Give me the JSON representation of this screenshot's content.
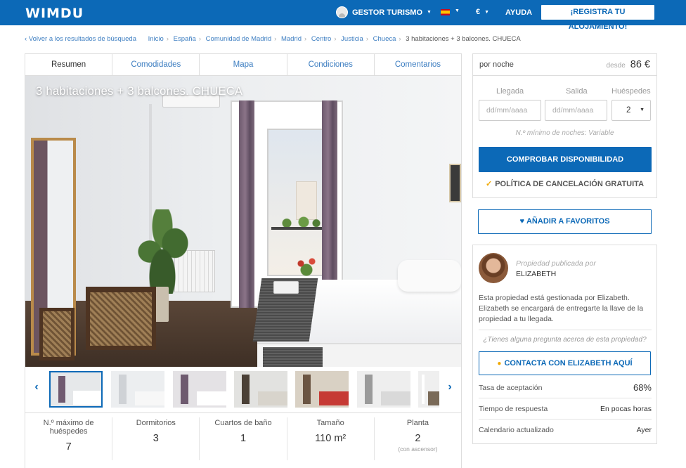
{
  "header": {
    "logo": "WIMDU",
    "user_menu": "GESTOR TURISMO",
    "currency": "€",
    "help": "AYUDA",
    "register": "¡REGISTRA TU ALOJAMIENTO!",
    "brand_color": "#0c69b7"
  },
  "breadcrumb": {
    "back": "Volver a los resultados de búsqueda",
    "items": [
      "Inicio",
      "España",
      "Comunidad de Madrid",
      "Madrid",
      "Centro",
      "Justicia",
      "Chueca"
    ],
    "current": "3 habitaciones + 3 balcones. CHUECA"
  },
  "tabs": [
    "Resumen",
    "Comodidades",
    "Mapa",
    "Condiciones",
    "Comentarios"
  ],
  "listing": {
    "title": "3 habitaciones + 3 balcones. CHUECA"
  },
  "gallery": {
    "prev_icon": "chevron-left-icon",
    "next_icon": "chevron-right-icon",
    "thumbnails": [
      {
        "bg": "#e6e8ea",
        "a": "#705a70",
        "b": "#ffffff"
      },
      {
        "bg": "#eceef0",
        "a": "#cfd2d6",
        "b": "#f7f7f7"
      },
      {
        "bg": "#e4e2e5",
        "a": "#6e5a6f",
        "b": "#ffffff"
      },
      {
        "bg": "#e2e2e0",
        "a": "#4a4036",
        "b": "#d8d4cc"
      },
      {
        "bg": "#d9d1c4",
        "a": "#6b5543",
        "b": "#c63a34"
      },
      {
        "bg": "#eeeeee",
        "a": "#9a9a9a",
        "b": "#d9d9d9"
      },
      {
        "bg": "#efefef",
        "a": "#ffffff",
        "b": "#7a6a58"
      }
    ]
  },
  "facts": [
    {
      "label": "N.º máximo de huéspedes",
      "value": "7",
      "sub": ""
    },
    {
      "label": "Dormitorios",
      "value": "3",
      "sub": ""
    },
    {
      "label": "Cuartos de baño",
      "value": "1",
      "sub": ""
    },
    {
      "label": "Tamaño",
      "value": "110 m²",
      "sub": ""
    },
    {
      "label": "Planta",
      "value": "2",
      "sub": "(con ascensor)"
    }
  ],
  "booking": {
    "per_night": "por noche",
    "from": "desde",
    "price": "86 €",
    "checkin_label": "Llegada",
    "checkout_label": "Salida",
    "guests_label": "Huéspedes",
    "checkin_placeholder": "dd/mm/aaaa",
    "checkout_placeholder": "dd/mm/aaaa",
    "guests_value": "2",
    "min_nights": "N.º mínimo de noches: Variable",
    "check_button": "COMPROBAR DISPONIBILIDAD",
    "cancellation": "POLÍTICA DE CANCELACIÓN GRATUITA",
    "accent_color": "#f0a800"
  },
  "favorites_button": "AÑADIR A FAVORITOS",
  "host": {
    "published_by": "Propiedad publicada por",
    "name": "ELIZABETH",
    "description": "Esta propiedad está gestionada por Elizabeth. Elizabeth se encargará de entregarte la llave de la propiedad a tu llegada.",
    "question": "¿Tienes alguna pregunta acerca de esta propiedad?",
    "contact_button": "CONTACTA CON ELIZABETH AQUÍ",
    "stats": [
      {
        "label": "Tasa de aceptación",
        "value": "68%"
      },
      {
        "label": "Tiempo de respuesta",
        "value": "En pocas horas"
      },
      {
        "label": "Calendario actualizado",
        "value": "Ayer"
      }
    ]
  }
}
